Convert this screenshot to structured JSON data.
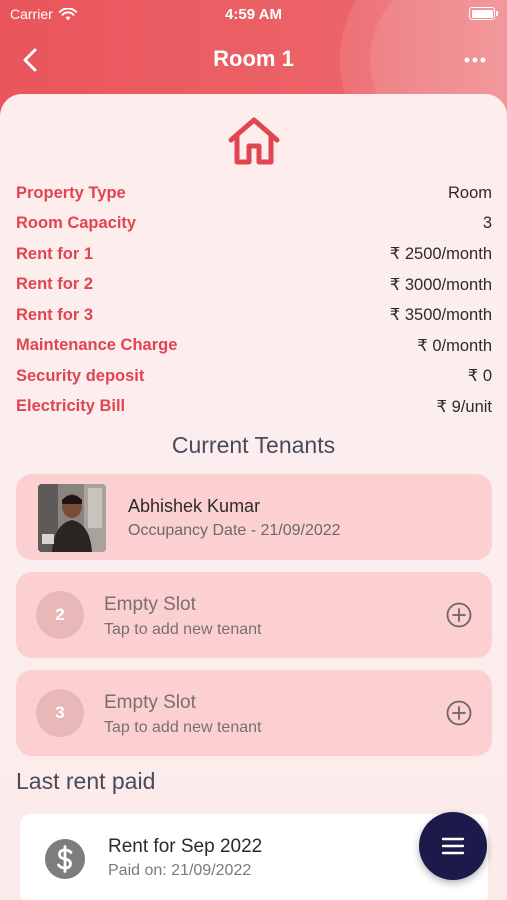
{
  "status_bar": {
    "carrier": "Carrier",
    "time": "4:59 AM"
  },
  "nav": {
    "title": "Room 1"
  },
  "details": [
    {
      "label": "Property Type",
      "value": "Room"
    },
    {
      "label": "Room Capacity",
      "value": "3"
    },
    {
      "label": "Rent for 1",
      "value": "₹ 2500/month"
    },
    {
      "label": "Rent for 2",
      "value": "₹ 3000/month"
    },
    {
      "label": "Rent for 3",
      "value": "₹ 3500/month"
    },
    {
      "label": "Maintenance Charge",
      "value": "₹ 0/month"
    },
    {
      "label": "Security deposit",
      "value": "₹ 0"
    },
    {
      "label": "Electricity Bill",
      "value": "₹ 9/unit"
    }
  ],
  "tenants_section": {
    "title": "Current Tenants"
  },
  "tenant": {
    "name": "Abhishek Kumar",
    "occupancy": "Occupancy Date - 21/09/2022"
  },
  "slots": [
    {
      "number": "2",
      "title": "Empty Slot",
      "subtitle": "Tap to add new tenant"
    },
    {
      "number": "3",
      "title": "Empty Slot",
      "subtitle": "Tap to add new tenant"
    }
  ],
  "last_rent": {
    "title": "Last rent paid",
    "entry_title": "Rent for Sep 2022",
    "entry_paid": "Paid on: 21/09/2022"
  },
  "colors": {
    "accent": "#e04550",
    "header": "#e9555b",
    "card": "#fcd0d1",
    "fab": "#1c1a4a"
  }
}
